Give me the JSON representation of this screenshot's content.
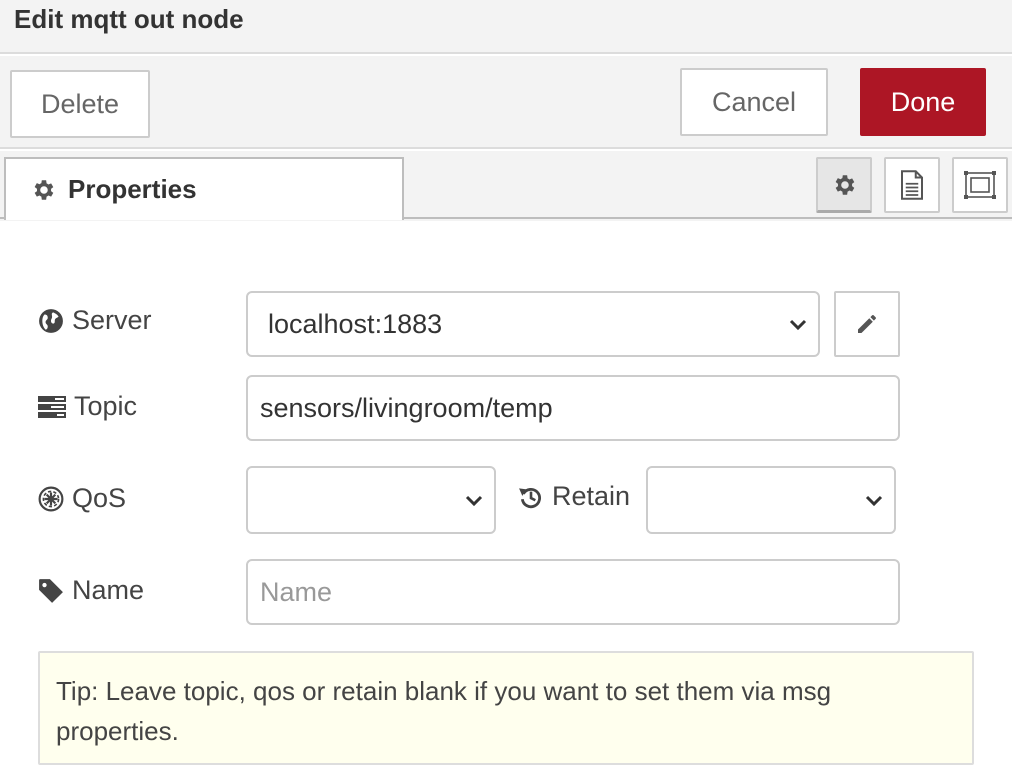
{
  "header": {
    "title": "Edit mqtt out node"
  },
  "toolbar": {
    "delete_label": "Delete",
    "cancel_label": "Cancel",
    "done_label": "Done",
    "done_color": "#ad1625"
  },
  "tabs": {
    "active_label": "Properties",
    "active_icon": "gear-icon",
    "side_buttons": [
      "gear-icon",
      "document-icon",
      "frame-icon"
    ]
  },
  "form": {
    "server": {
      "label": "Server",
      "icon": "globe-icon",
      "value": "localhost:1883"
    },
    "topic": {
      "label": "Topic",
      "icon": "tasks-icon",
      "value": "sensors/livingroom/temp"
    },
    "qos": {
      "label": "QoS",
      "icon": "empire-icon",
      "value": ""
    },
    "retain": {
      "label": "Retain",
      "icon": "history-icon",
      "value": ""
    },
    "name": {
      "label": "Name",
      "icon": "tag-icon",
      "value": "",
      "placeholder": "Name"
    }
  },
  "tip": "Tip: Leave topic, qos or retain blank if you want to set them via msg properties."
}
